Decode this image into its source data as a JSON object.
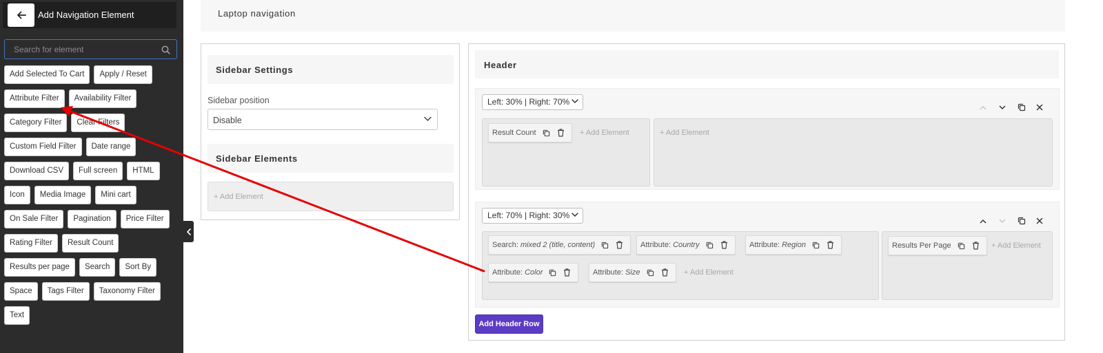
{
  "panel": {
    "title": "Add Navigation Element",
    "search_placeholder": "Search for element",
    "elements": [
      "Add Selected To Cart",
      "Apply / Reset",
      "Attribute Filter",
      "Availability Filter",
      "Category Filter",
      "Clear Filters",
      "Custom Field Filter",
      "Date range",
      "Download CSV",
      "Full screen",
      "HTML",
      "Icon",
      "Media Image",
      "Mini cart",
      "On Sale Filter",
      "Pagination",
      "Price Filter",
      "Rating Filter",
      "Result Count",
      "Results per page",
      "Search",
      "Sort By",
      "Space",
      "Tags Filter",
      "Taxonomy Filter",
      "Text"
    ]
  },
  "topbar": {
    "title": "Laptop navigation"
  },
  "sidebar": {
    "settings_title": "Sidebar Settings",
    "position_label": "Sidebar position",
    "position_value": "Disable",
    "elements_title": "Sidebar Elements",
    "add_element": "+ Add Element"
  },
  "header": {
    "title": "Header",
    "add_row_label": "Add Header Row",
    "add_element": "+ Add Element",
    "rows": [
      {
        "layout": "Left: 30% | Right: 70%",
        "left": [
          {
            "label": "Result Count"
          }
        ],
        "right": []
      },
      {
        "layout": "Left: 70% | Right: 30%",
        "left": [
          {
            "label": "Search:",
            "detail": "mixed 2 (title, content)"
          },
          {
            "label": "Attribute:",
            "detail": "Country"
          },
          {
            "label": "Attribute:",
            "detail": "Region"
          },
          {
            "label": "Attribute:",
            "detail": "Color"
          },
          {
            "label": "Attribute:",
            "detail": "Size"
          }
        ],
        "right": [
          {
            "label": "Results Per Page"
          }
        ]
      }
    ]
  },
  "colors": {
    "accent": "#5b3cc4",
    "annotation": "#e60000",
    "panel_bg": "#2c2c2c"
  },
  "icons": [
    "arrow-left-icon",
    "search-icon",
    "chevron-left-icon",
    "chevron-down-icon",
    "chevron-up-icon",
    "copy-icon",
    "trash-icon",
    "close-icon"
  ]
}
